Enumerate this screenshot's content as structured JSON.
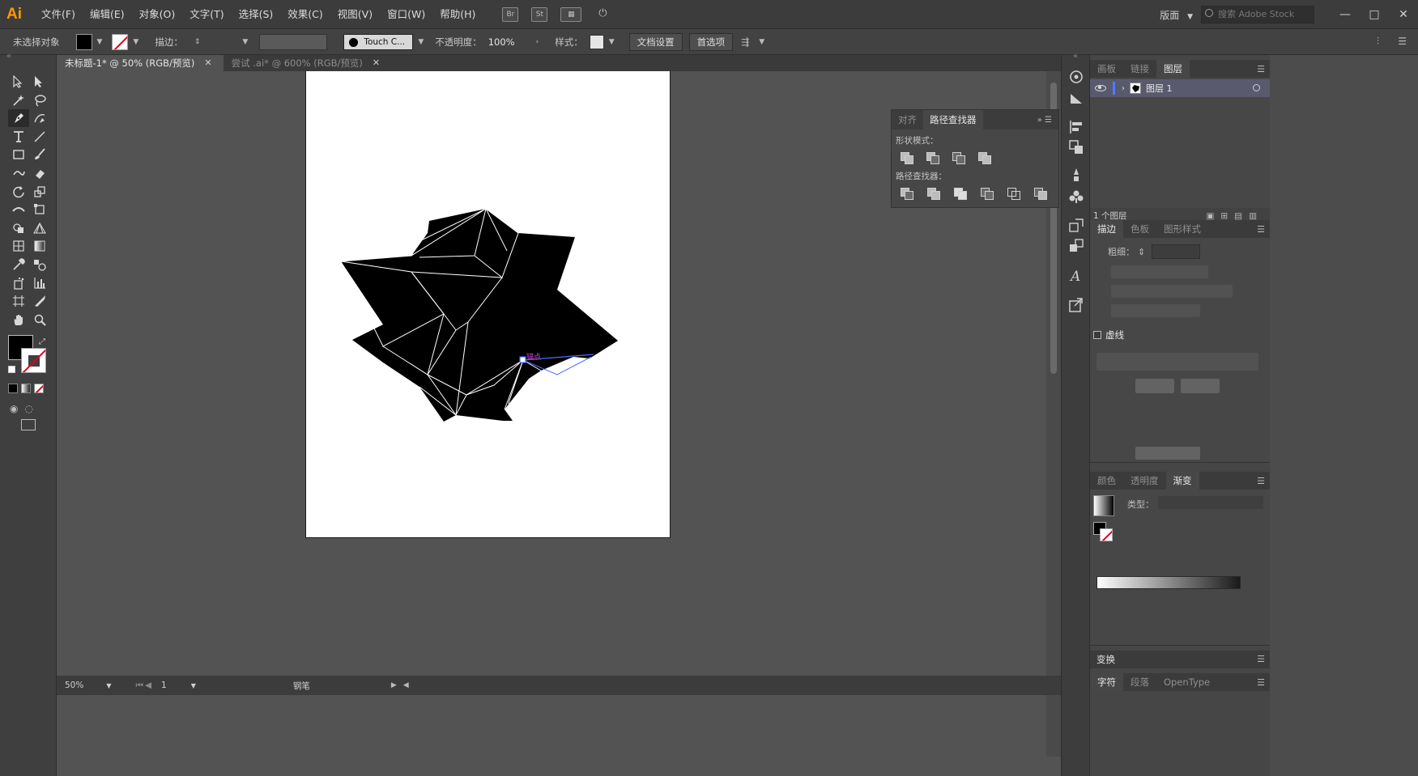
{
  "app": {
    "logo": "Ai"
  },
  "menu": [
    "文件(F)",
    "编辑(E)",
    "对象(O)",
    "文字(T)",
    "选择(S)",
    "效果(C)",
    "视图(V)",
    "窗口(W)",
    "帮助(H)"
  ],
  "menubar_icons": {
    "bridge": "Br",
    "stock": "St"
  },
  "workspace": "版面",
  "search": {
    "placeholder": "搜索 Adobe Stock"
  },
  "window_controls": {
    "minimize": "—",
    "maximize": "□",
    "close": "✕"
  },
  "control_bar": {
    "selection_status": "未选择对象",
    "stroke_label": "描边：",
    "brush_name": "Touch C...",
    "opacity_label": "不透明度：",
    "opacity_value": "100%",
    "style_label": "样式：",
    "doc_setup": "文档设置",
    "preferences": "首选项"
  },
  "tabs": [
    {
      "label": "未标题-1* @ 50% (RGB/预览)",
      "close": "✕"
    },
    {
      "label": "尝试 .ai* @ 600% (RGB/预览)",
      "close": "✕"
    }
  ],
  "canvas": {
    "anchor_hint": "锚点"
  },
  "pathfinder_panel": {
    "tabs": [
      "对齐",
      "路径查找器"
    ],
    "shape_modes_label": "形状模式：",
    "pathfinders_label": "路径查找器："
  },
  "layers_panel": {
    "tabs": [
      "画板",
      "链接",
      "图层"
    ],
    "layer_name": "图层 1",
    "footer": "1 个图层"
  },
  "stroke_panel": {
    "tabs": [
      "描边",
      "色板",
      "图形样式"
    ],
    "weight_label": "粗细：",
    "dashed_label": "虚线"
  },
  "gradient_panel": {
    "tabs": [
      "颜色",
      "透明度",
      "渐变"
    ],
    "type_label": "类型："
  },
  "transform_panel": {
    "title": "变换"
  },
  "type_panel": {
    "tabs": [
      "字符",
      "段落",
      "OpenType"
    ]
  },
  "status_bar": {
    "zoom": "50%",
    "artboard": "1",
    "tool": "钢笔"
  },
  "colors": {
    "accent_anchor": "#e040e0",
    "path_highlight": "#4a6cff",
    "layer_color": "#4f7bff"
  }
}
